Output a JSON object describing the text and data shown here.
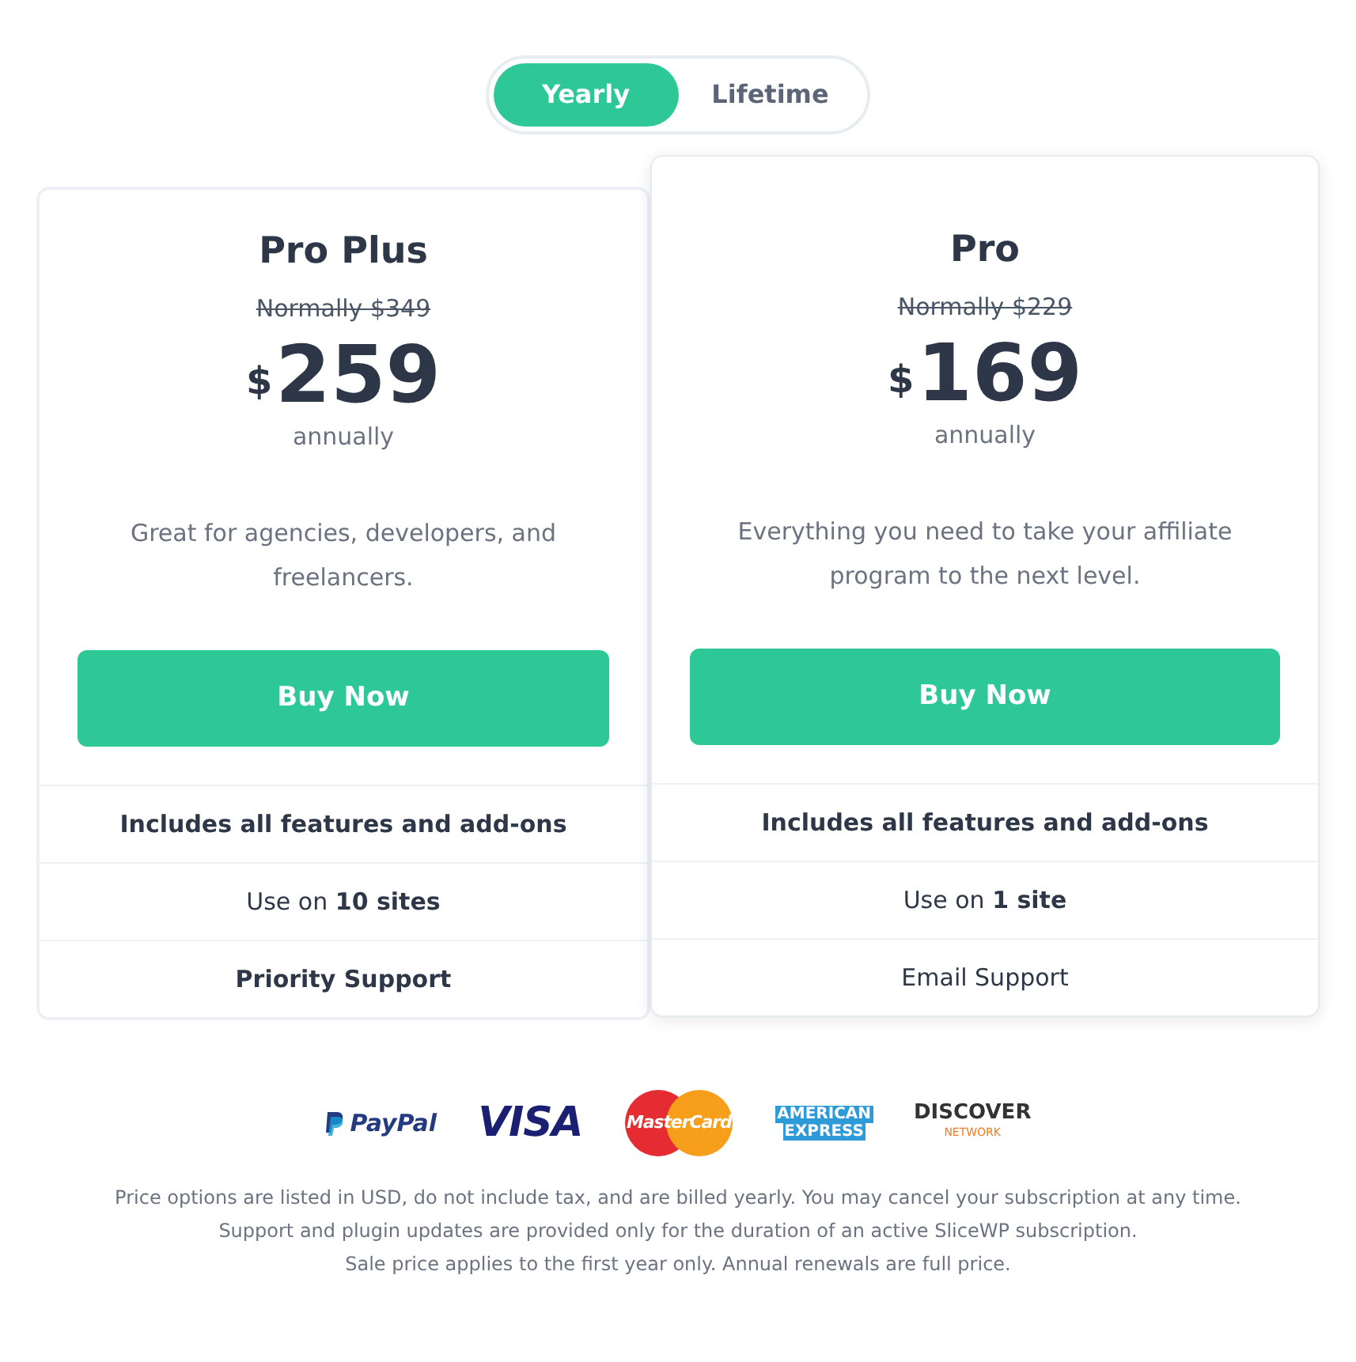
{
  "billing_toggle": [
    {
      "label": "Yearly",
      "selected": true
    },
    {
      "label": "Lifetime",
      "selected": false
    }
  ],
  "plans": [
    {
      "name": "Pro Plus",
      "featured": false,
      "original_price": "Normally $349",
      "currency": "$",
      "price": "259",
      "period": "annually",
      "description": "Great for agencies, developers, and freelancers.",
      "button": "Buy Now",
      "features": [
        {
          "text": "Includes all features and add-ons",
          "bold": true
        },
        {
          "text": "Use on **10 sites**",
          "bold": false
        },
        {
          "text": "Priority Support",
          "bold": true
        }
      ]
    },
    {
      "name": "Pro",
      "featured": true,
      "original_price": "Normally $229",
      "currency": "$",
      "price": "169",
      "period": "annually",
      "description": "Everything you need to take your affiliate program to the next level.",
      "button": "Buy Now",
      "features": [
        {
          "text": "Includes all features and add-ons",
          "bold": true
        },
        {
          "text": "Use on **1 site**",
          "bold": false
        },
        {
          "text": "Email Support",
          "bold": false
        }
      ]
    }
  ],
  "payment_logos": [
    {
      "kind": "paypal",
      "text": "PayPal"
    },
    {
      "kind": "visa",
      "text": "VISA"
    },
    {
      "kind": "mastercard",
      "text": "MasterCard"
    },
    {
      "kind": "amex",
      "lines": [
        "AMERICAN",
        "EXPRESS"
      ]
    },
    {
      "kind": "discover",
      "text": "DISCOVER",
      "sub": "NETWORK"
    }
  ],
  "notes": [
    "Price options are listed in USD, do not include tax, and are billed yearly. You may cancel your subscription at any time.",
    "Support and plugin updates are provided only for the duration of an active SliceWP subscription.",
    "Sale price applies to the first year only. Annual renewals are full price."
  ]
}
